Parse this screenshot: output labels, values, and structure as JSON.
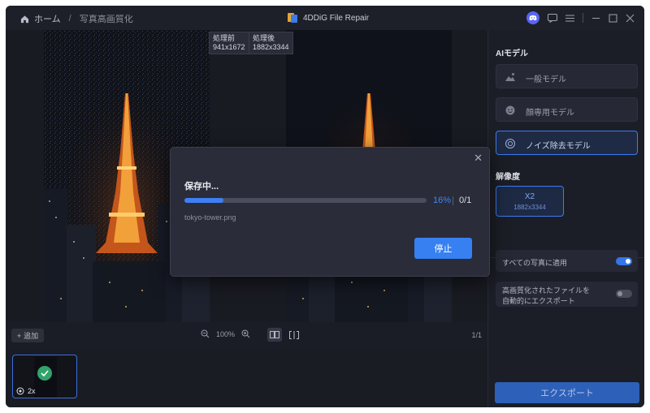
{
  "titlebar": {
    "home_label": "ホーム",
    "separator": "/",
    "page_label": "写真高画質化",
    "app_title": "4DDiG File Repair"
  },
  "preview": {
    "before_label": "処理前",
    "before_size": "941x1672",
    "after_label": "処理後",
    "after_size": "1882x3344"
  },
  "toolbar": {
    "add_label": "追加",
    "zoom_value": "100%",
    "page_count": "1/1"
  },
  "thumbnail": {
    "scale_badge": "2x"
  },
  "right_panel": {
    "ai_model_title": "AIモデル",
    "models": [
      {
        "label": "一般モデル",
        "selected": false
      },
      {
        "label": "顔専用モデル",
        "selected": false
      },
      {
        "label": "ノイズ除去モデル",
        "selected": true
      }
    ],
    "resolution_title": "解像度",
    "resolution": {
      "scale": "X2",
      "size": "1882x3344"
    },
    "apply_all_label": "すべての写真に適用",
    "apply_all_on": true,
    "auto_export_label_line1": "高画質化されたファイルを",
    "auto_export_label_line2": "自動的にエクスポート",
    "auto_export_on": false,
    "export_button": "エクスポート"
  },
  "dialog": {
    "title": "保存中...",
    "progress": 0.16,
    "percent_text": "16%",
    "count_text": "0/1",
    "filename": "tokyo-tower.png",
    "stop_button": "停止"
  },
  "colors": {
    "accent": "#3680f2",
    "background": "#1b1d26",
    "success": "#32a36b"
  },
  "icons": [
    "home-icon",
    "app-logo-icon",
    "discord-icon",
    "chat-icon",
    "menu-icon",
    "minimize-icon",
    "maximize-icon",
    "close-icon",
    "plus-icon",
    "zoom-out-icon",
    "zoom-in-icon",
    "compare-icon",
    "split-icon",
    "landscape-icon",
    "face-icon",
    "denoise-icon",
    "check-icon",
    "settings-icon"
  ]
}
